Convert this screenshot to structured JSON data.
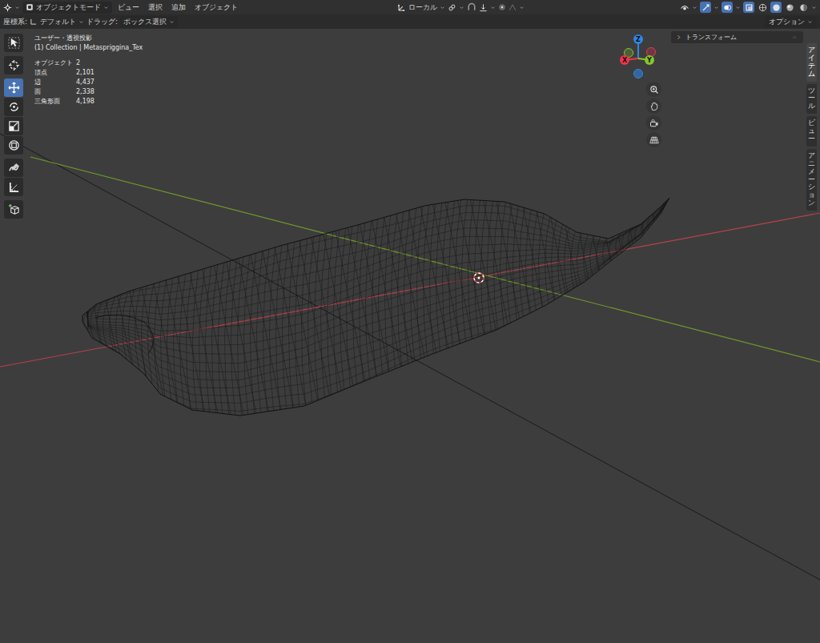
{
  "header": {
    "mode": "オブジェクトモード",
    "menus": [
      "ビュー",
      "選択",
      "追加",
      "オブジェクト"
    ],
    "transform_orientation": "ローカル"
  },
  "tool_settings": {
    "orientation_label": "座標系:",
    "orientation_value": "デフォルト",
    "drag_label": "ドラッグ:",
    "drag_value": "ボックス選択",
    "options": "オプション"
  },
  "viewport_toggles": [
    {
      "kind": "gizmo",
      "on": true
    },
    {
      "kind": "overlays",
      "on": true
    },
    {
      "kind": "xray",
      "on": true
    }
  ],
  "shading": [
    {
      "kind": "wireframe",
      "selected": false
    },
    {
      "kind": "solid",
      "selected": true
    },
    {
      "kind": "material",
      "selected": false
    },
    {
      "kind": "rendered",
      "selected": false
    }
  ],
  "toolbar": [
    {
      "kind": "select",
      "selected": false
    },
    {
      "kind": "cursor",
      "selected": false
    },
    {
      "kind": "move",
      "selected": true
    },
    {
      "kind": "rotate",
      "selected": false
    },
    {
      "kind": "scale",
      "selected": false
    },
    {
      "kind": "transform",
      "selected": false
    },
    {
      "kind": "annotate",
      "selected": false
    },
    {
      "kind": "measure",
      "selected": false
    },
    {
      "kind": "add_cube",
      "selected": false
    }
  ],
  "viewport": {
    "view": "ユーザー・透視投影",
    "collection": "(1) Collection | Metaspriggina_Tex",
    "stats": [
      {
        "label": "オブジェクト",
        "value": "2"
      },
      {
        "label": "頂点",
        "value": "2,101"
      },
      {
        "label": "辺",
        "value": "4,437"
      },
      {
        "label": "面",
        "value": "2,338"
      },
      {
        "label": "三角形面",
        "value": "4,198"
      }
    ]
  },
  "gizmo": {
    "axes": [
      {
        "label": "Z",
        "color": "#2f86e6"
      },
      {
        "label": "X",
        "color": "#f0344f"
      },
      {
        "label": "Y",
        "color": "#87c52a"
      }
    ]
  },
  "sidebar": {
    "panels": [
      {
        "label": "トランスフォーム",
        "expanded": false
      }
    ],
    "tabs": [
      {
        "label": "アイテム",
        "selected": true
      },
      {
        "label": "ツール",
        "selected": false
      },
      {
        "label": "ビュー",
        "selected": false
      },
      {
        "label": "アニメーション",
        "selected": false
      }
    ]
  }
}
